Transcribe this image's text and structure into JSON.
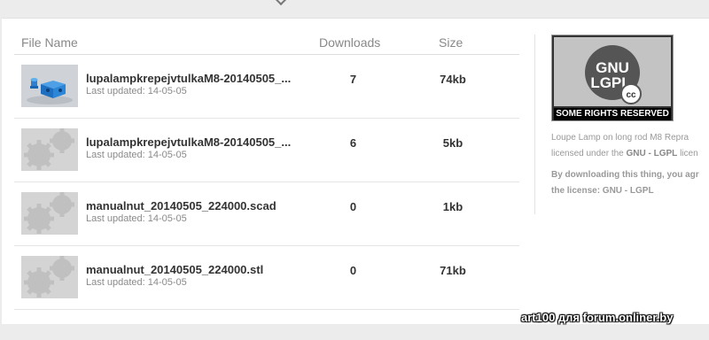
{
  "table": {
    "headers": {
      "name": "File Name",
      "downloads": "Downloads",
      "size": "Size"
    },
    "rows": [
      {
        "name": "lupalampkrepejvtulkaM8-20140505_...",
        "updated": "Last updated: 14-05-05",
        "downloads": "7",
        "size": "74kb",
        "thumb": "model-render-icon"
      },
      {
        "name": "lupalampkrepejvtulkaM8-20140505_...",
        "updated": "Last updated: 14-05-05",
        "downloads": "6",
        "size": "5kb",
        "thumb": "gears-icon"
      },
      {
        "name": "manualnut_20140505_224000.scad",
        "updated": "Last updated: 14-05-05",
        "downloads": "0",
        "size": "1kb",
        "thumb": "gears-icon"
      },
      {
        "name": "manualnut_20140505_224000.stl",
        "updated": "Last updated: 14-05-05",
        "downloads": "0",
        "size": "71kb",
        "thumb": "gears-icon"
      }
    ]
  },
  "license": {
    "badge_top1": "GNU",
    "badge_top2": "LGPL",
    "badge_cc": "cc",
    "badge_bar": "SOME RIGHTS RESERVED",
    "line1": "Loupe Lamp on long rod M8 Repra",
    "line2_pre": "licensed under the ",
    "line2_bold": "GNU - LGPL",
    "line2_post": " licen",
    "line3": "By downloading this thing, you agr",
    "line4": "the license: GNU - LGPL"
  },
  "watermark": "art100 для forum.onliner.by"
}
